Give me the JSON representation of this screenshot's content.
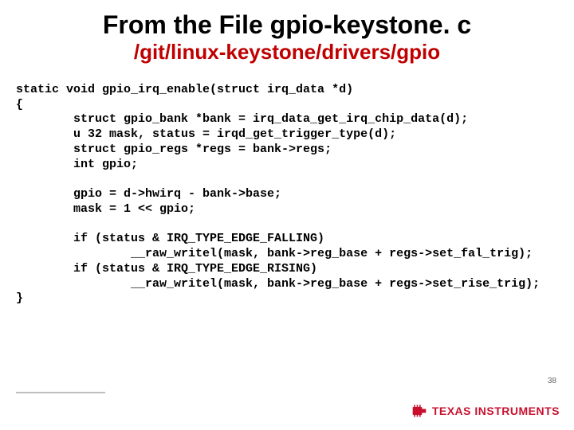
{
  "title": "From the File gpio-keystone. c",
  "subtitle": "/git/linux-keystone/drivers/gpio",
  "code": "static void gpio_irq_enable(struct irq_data *d)\n{\n        struct gpio_bank *bank = irq_data_get_irq_chip_data(d);\n        u 32 mask, status = irqd_get_trigger_type(d);\n        struct gpio_regs *regs = bank->regs;\n        int gpio;\n\n        gpio = d->hwirq - bank->base;\n        mask = 1 << gpio;\n\n        if (status & IRQ_TYPE_EDGE_FALLING)\n                __raw_writel(mask, bank->reg_base + regs->set_fal_trig);\n        if (status & IRQ_TYPE_EDGE_RISING)\n                __raw_writel(mask, bank->reg_base + regs->set_rise_trig);\n}",
  "page_number": "38",
  "logo_text": "TEXAS INSTRUMENTS"
}
